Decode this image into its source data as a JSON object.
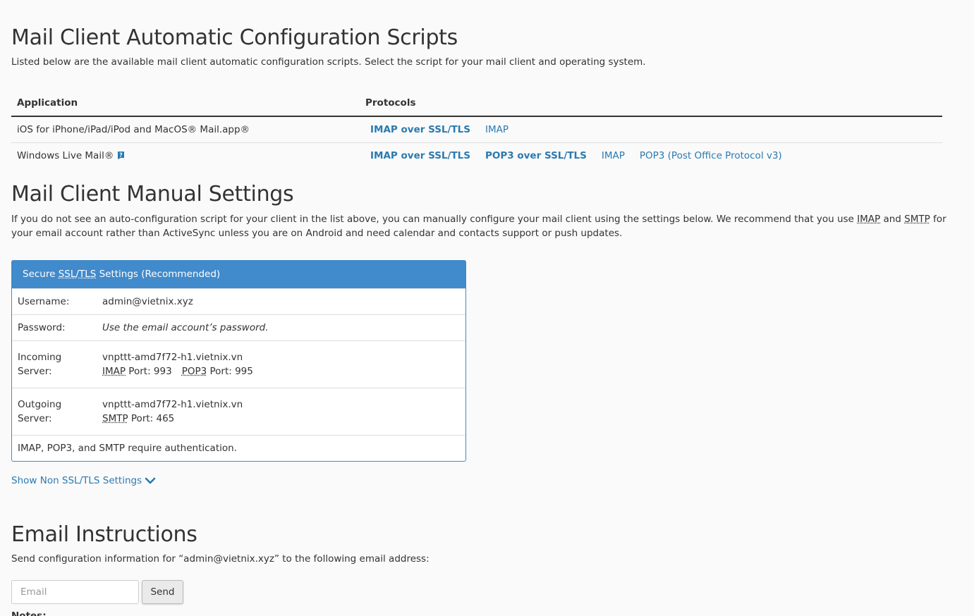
{
  "auto": {
    "title": "Mail Client Automatic Configuration Scripts",
    "description": "Listed below are the available mail client automatic configuration scripts. Select the script for your mail client and operating system.",
    "headers": {
      "application": "Application",
      "protocols": "Protocols"
    },
    "rows": [
      {
        "app": "iOS for iPhone/iPad/iPod and MacOS® Mail.app®",
        "protocols": [
          "IMAP over SSL/TLS",
          "IMAP"
        ]
      },
      {
        "app": "Windows Live Mail®",
        "protocols": [
          "IMAP over SSL/TLS",
          "POP3 over SSL/TLS",
          "IMAP",
          "POP3 (Post Office Protocol v3)"
        ]
      }
    ]
  },
  "manual": {
    "title": "Mail Client Manual Settings",
    "desc_part1": "If you do not see an auto-configuration script for your client in the list above, you can manually configure your mail client using the settings below. We recommend that you use ",
    "desc_imap": "IMAP",
    "desc_and": " and ",
    "desc_smtp": "SMTP",
    "desc_part2": " for your email account rather than ActiveSync unless you are on Android and need calendar and contacts support or push updates.",
    "panel": {
      "header_prefix": "Secure ",
      "header_ssl": "SSL",
      "header_slash": "/",
      "header_tls": "TLS",
      "header_suffix": " Settings (Recommended)",
      "username_label": "Username:",
      "username_value": "admin@vietnix.xyz",
      "password_label": "Password:",
      "password_value": "Use the email account’s password.",
      "incoming_label": "Incoming Server:",
      "incoming_host": "vnpttt-amd7f72-h1.vietnix.vn",
      "imap_abbr": "IMAP",
      "imap_port": " Port: 993",
      "pop3_abbr": "POP3",
      "pop3_port": " Port: 995",
      "outgoing_label": "Outgoing Server:",
      "outgoing_host": "vnpttt-amd7f72-h1.vietnix.vn",
      "smtp_abbr": "SMTP",
      "smtp_port": " Port: 465",
      "footer": "IMAP, POP3, and SMTP require authentication."
    },
    "show_non_ssl": "Show Non SSL/TLS Settings"
  },
  "email_instructions": {
    "title": "Email Instructions",
    "description": "Send configuration information for “admin@vietnix.xyz” to the following email address:",
    "input_placeholder": "Email",
    "send_label": "Send",
    "notes_label": "Notes:"
  },
  "colors": {
    "link": "#2a7ab0",
    "panel_header": "#418acb"
  }
}
